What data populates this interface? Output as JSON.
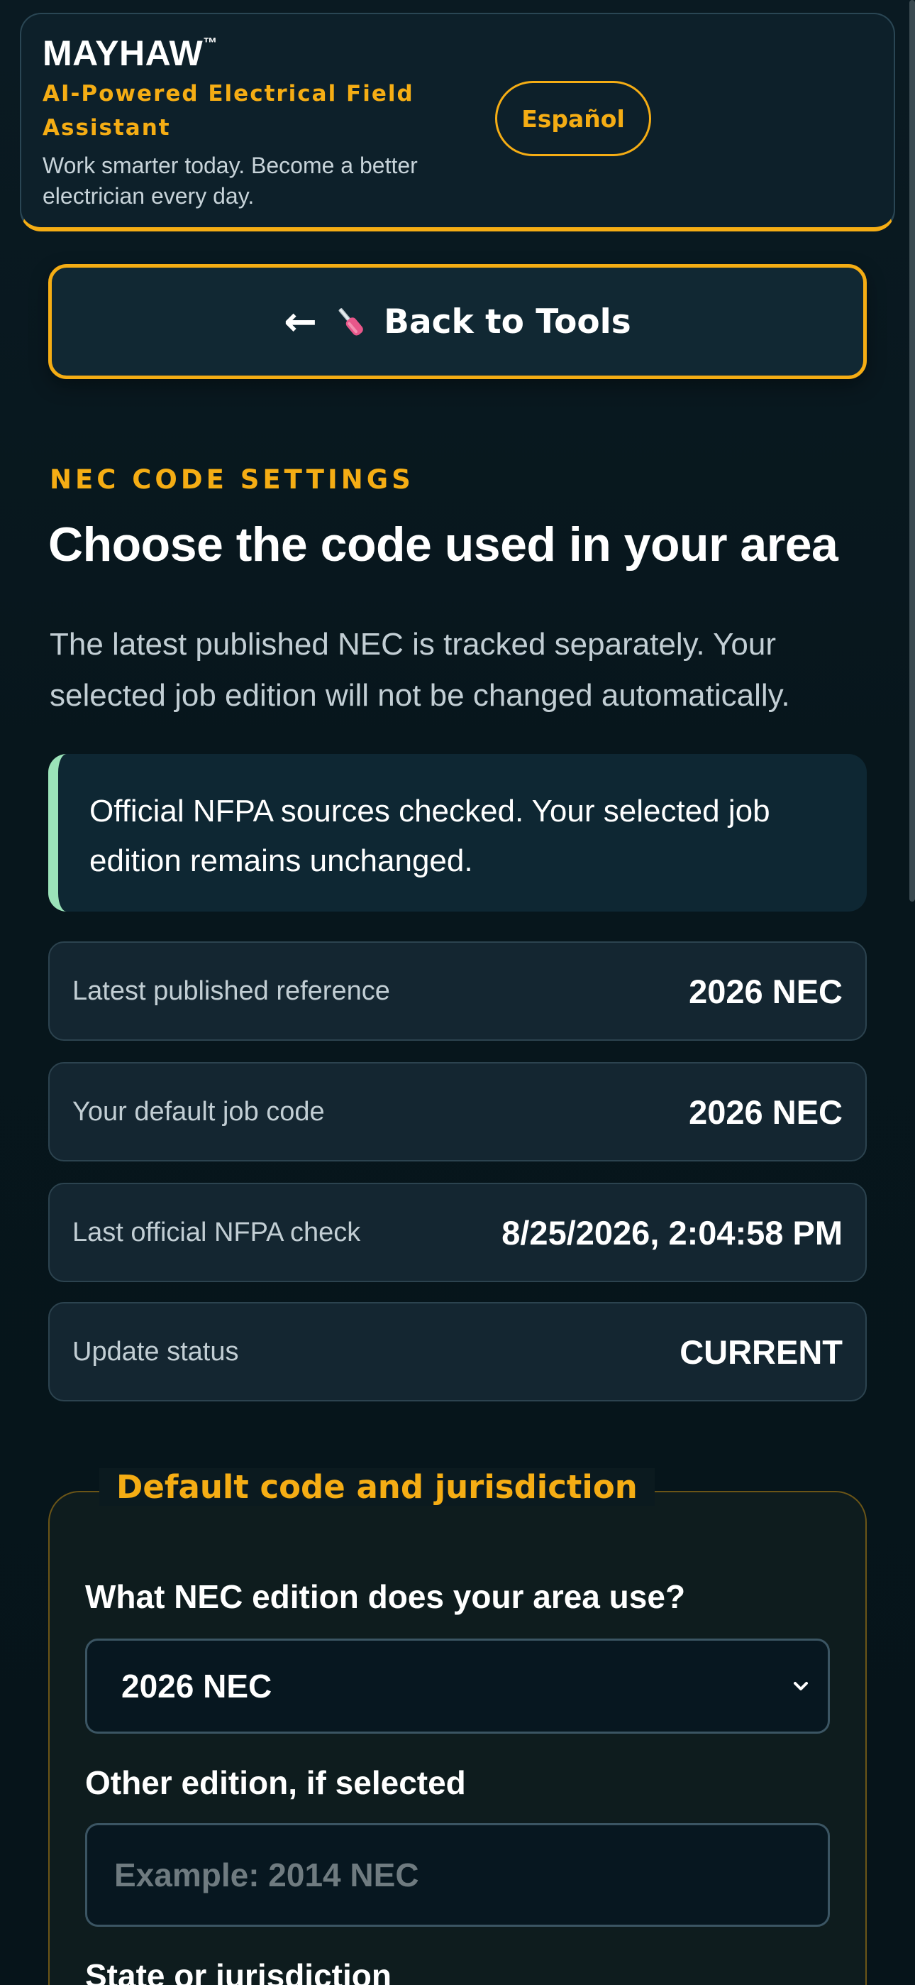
{
  "header": {
    "brand": "MAYHAW",
    "trademark": "™",
    "tagline": "AI-Powered Electrical Field Assistant",
    "subline": "Work smarter today. Become a better electrician every day.",
    "language_button": "Español"
  },
  "back_button": {
    "arrow": "←",
    "label": "Back to Tools",
    "icon": "screwdriver-icon"
  },
  "section": {
    "eyebrow": "NEC CODE SETTINGS",
    "title": "Choose the code used in your area",
    "description": "The latest published NEC is tracked separately. Your selected job edition will not be changed automatically."
  },
  "notice": {
    "text": "Official NFPA sources checked. Your selected job edition remains unchanged.",
    "accent_color": "#9be3b9"
  },
  "info_rows": [
    {
      "label": "Latest published reference",
      "value": "2026 NEC"
    },
    {
      "label": "Your default job code",
      "value": "2026 NEC"
    },
    {
      "label": "Last official NFPA check",
      "value": "8/25/2026, 2:04:58 PM"
    },
    {
      "label": "Update status",
      "value": "CURRENT"
    }
  ],
  "form": {
    "legend": "Default code and jurisdiction",
    "edition_label": "What NEC edition does your area use?",
    "edition_value": "2026 NEC",
    "other_label": "Other edition, if selected",
    "other_placeholder": "Example: 2014 NEC",
    "jurisdiction_label": "State or jurisdiction"
  },
  "colors": {
    "accent": "#f5ad14",
    "background": "#07161d",
    "card": "#142631",
    "notice_bar": "#9be3b9"
  }
}
